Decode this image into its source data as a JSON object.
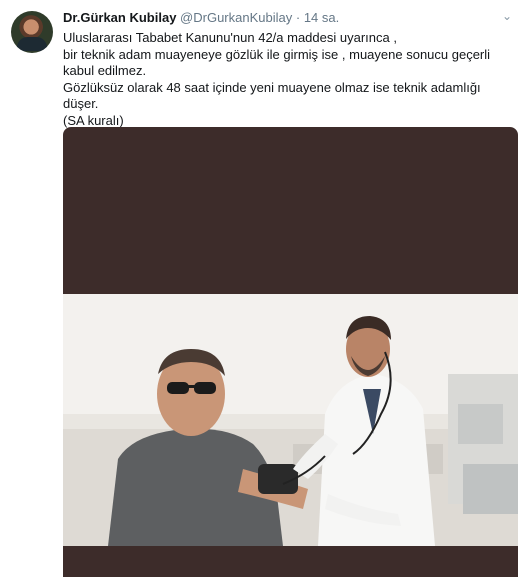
{
  "tweet": {
    "author_name": "Dr.Gürkan Kubilay",
    "author_handle": "@DrGurkanKubilay",
    "separator": "·",
    "time": "14 sa.",
    "lines": [
      "Uluslararası Tababet Kanunu'nun 42/a maddesi uyarınca ,",
      "bir teknik adam muayeneye gözlük ile girmiş ise , muayene sonucu geçerli kabul edilmez.",
      "Gözlüksüz olarak 48 saat içinde yeni muayene olmaz ise teknik adamlığı düşer.",
      "(SA kuralı)"
    ]
  },
  "icons": {
    "more": "chevron-down-icon"
  },
  "colors": {
    "text": "#14171a",
    "secondary": "#657786",
    "media_background": "#3d2c2a"
  }
}
